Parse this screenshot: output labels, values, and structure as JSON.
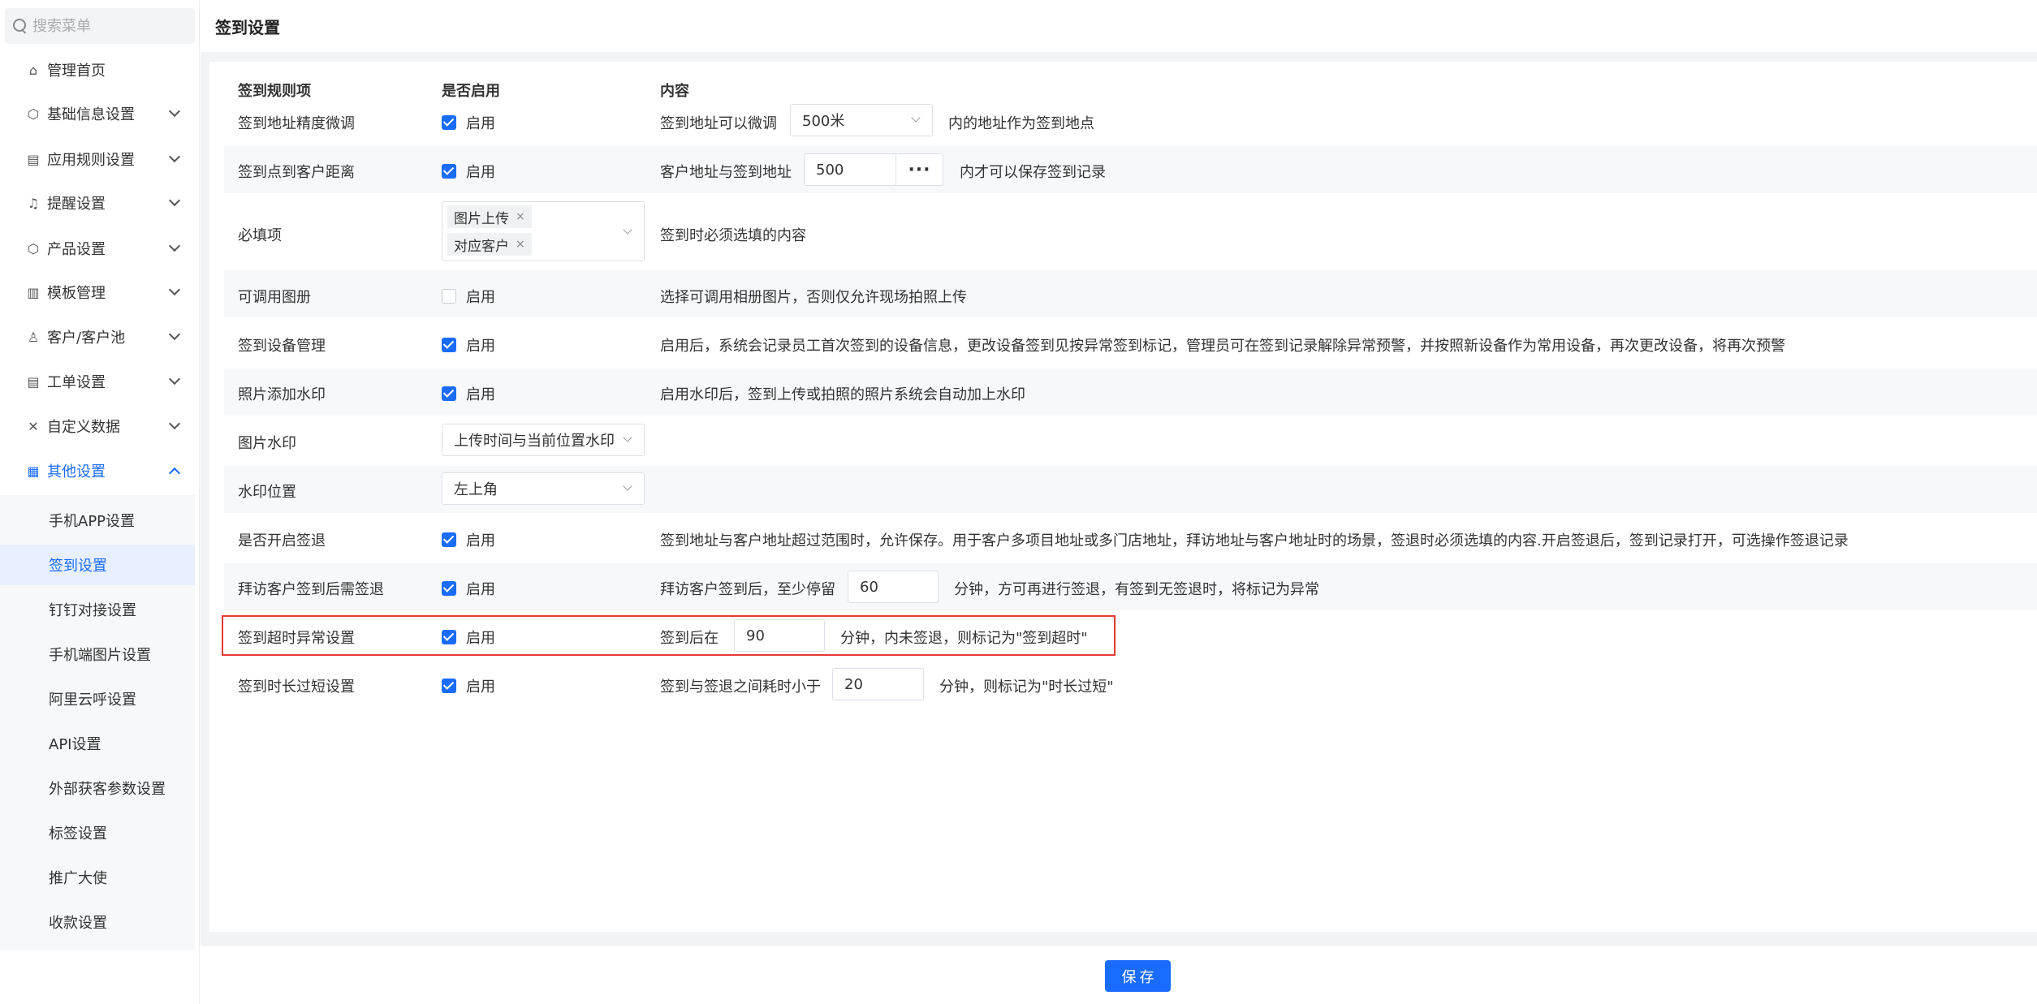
{
  "sidebar": {
    "search_placeholder": "搜索菜单",
    "items": [
      {
        "label": "管理首页",
        "icon": "⌂"
      },
      {
        "label": "基础信息设置",
        "icon": "⬡"
      },
      {
        "label": "应用规则设置",
        "icon": "▤"
      },
      {
        "label": "提醒设置",
        "icon": "♫"
      },
      {
        "label": "产品设置",
        "icon": "⬡"
      },
      {
        "label": "模板管理",
        "icon": "▥"
      },
      {
        "label": "客户/客户池",
        "icon": "♙"
      },
      {
        "label": "工单设置",
        "icon": "▤"
      },
      {
        "label": "自定义数据",
        "icon": "✕"
      },
      {
        "label": "其他设置",
        "icon": "▦"
      }
    ],
    "sub_items": [
      {
        "label": "手机APP设置"
      },
      {
        "label": "签到设置"
      },
      {
        "label": "钉钉对接设置"
      },
      {
        "label": "手机端图片设置"
      },
      {
        "label": "阿里云呼设置"
      },
      {
        "label": "API设置"
      },
      {
        "label": "外部获客参数设置"
      },
      {
        "label": "标签设置"
      },
      {
        "label": "推广大使"
      },
      {
        "label": "收款设置"
      }
    ]
  },
  "page": {
    "title": "签到设置",
    "headers": {
      "rule": "签到规则项",
      "enabled": "是否启用",
      "content": "内容"
    },
    "enable_label": "启用",
    "rows": {
      "r1": {
        "label": "签到地址精度微调",
        "pre": "签到地址可以微调",
        "select": "500米",
        "post": "内的地址作为签到地点"
      },
      "r2": {
        "label": "签到点到客户距离",
        "pre": "客户地址与签到地址",
        "value": "500",
        "dots": "···",
        "post": "内才可以保存签到记录"
      },
      "r3": {
        "label": "必填项",
        "tags": [
          "图片上传",
          "对应客户"
        ],
        "tag_close": "×",
        "post": "签到时必须选填的内容"
      },
      "r4": {
        "label": "可调用图册",
        "post": "选择可调用相册图片，否则仅允许现场拍照上传"
      },
      "r5": {
        "label": "签到设备管理",
        "post": "启用后，系统会记录员工首次签到的设备信息，更改设备签到见按异常签到标记，管理员可在签到记录解除异常预警，并按照新设备作为常用设备，再次更改设备，将再次预警"
      },
      "r6": {
        "label": "照片添加水印",
        "post": "启用水印后，签到上传或拍照的照片系统会自动加上水印"
      },
      "r7": {
        "label": "图片水印",
        "select": "上传时间与当前位置水印"
      },
      "r8": {
        "label": "水印位置",
        "select": "左上角"
      },
      "r9": {
        "label": "是否开启签退",
        "post": "签到地址与客户地址超过范围时，允许保存。用于客户多项目地址或多门店地址，拜访地址与客户地址时的场景，签退时必须选填的内容.开启签退后，签到记录打开，可选操作签退记录"
      },
      "r10": {
        "label": "拜访客户签到后需签退",
        "pre": "拜访客户签到后，至少停留",
        "value": "60",
        "post": "分钟，方可再进行签退，有签到无签退时，将标记为异常"
      },
      "r11": {
        "label": "签到超时异常设置",
        "pre": "签到后在",
        "value": "90",
        "post": "分钟，内未签退，则标记为\"签到超时\""
      },
      "r12": {
        "label": "签到时长过短设置",
        "pre": "签到与签退之间耗时小于",
        "value": "20",
        "post": "分钟，则标记为\"时长过短\""
      }
    },
    "save_label": "保存"
  },
  "colors": {
    "accent": "#1a6cff",
    "highlight_border": "#e53935",
    "row_bg": "#f7f8fa"
  }
}
